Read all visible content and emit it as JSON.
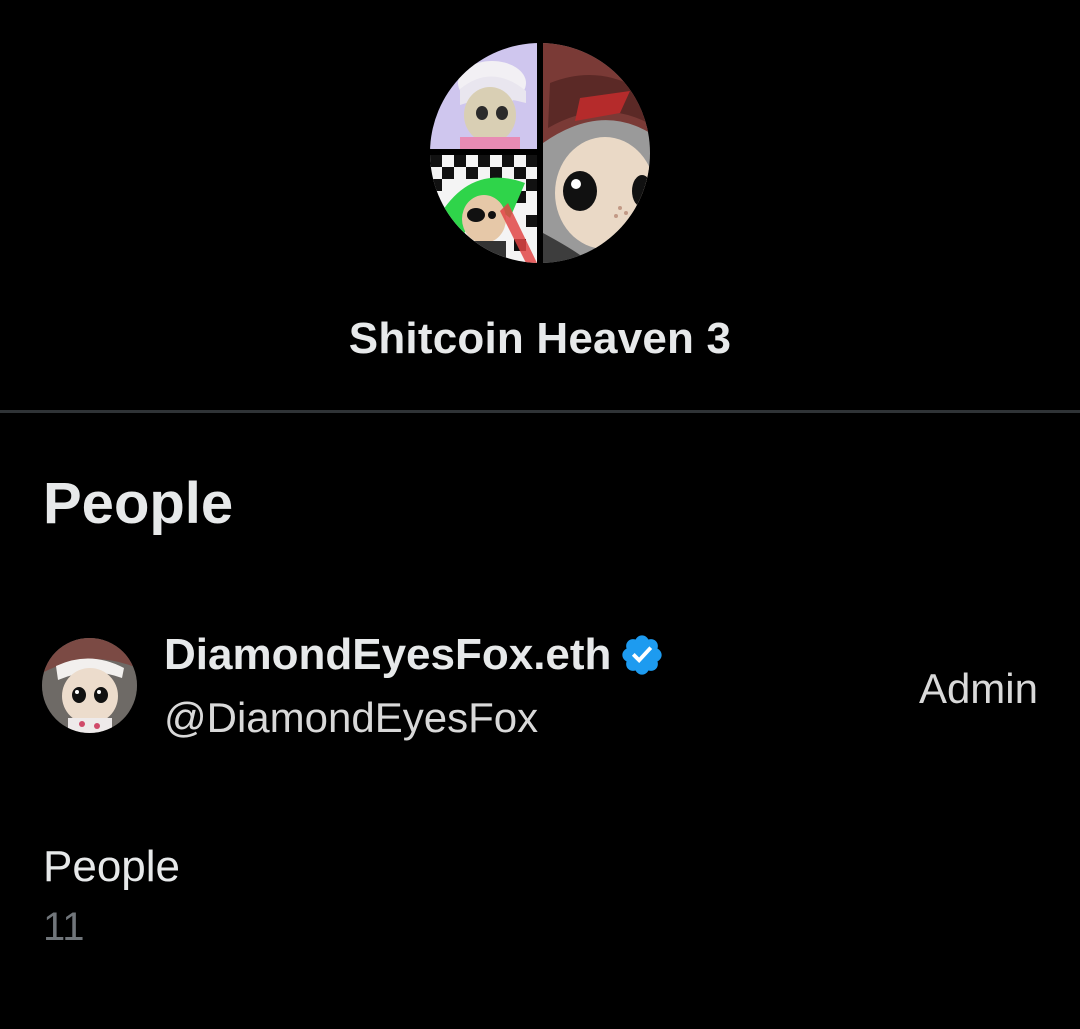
{
  "group": {
    "name": "Shitcoin Heaven 3",
    "avatar_icon": "group-collage-avatar"
  },
  "people_section": {
    "title": "People",
    "members": [
      {
        "display_name": "DiamondEyesFox.eth",
        "handle": "@DiamondEyesFox",
        "role": "Admin",
        "verified": true,
        "avatar_icon": "user-avatar"
      }
    ]
  },
  "people_count": {
    "label": "People",
    "value": "11"
  },
  "colors": {
    "background": "#000000",
    "primary_text": "#e7e9ea",
    "secondary_text": "#71767b",
    "verified_blue": "#1d9bf0",
    "divider": "#2f3336"
  }
}
